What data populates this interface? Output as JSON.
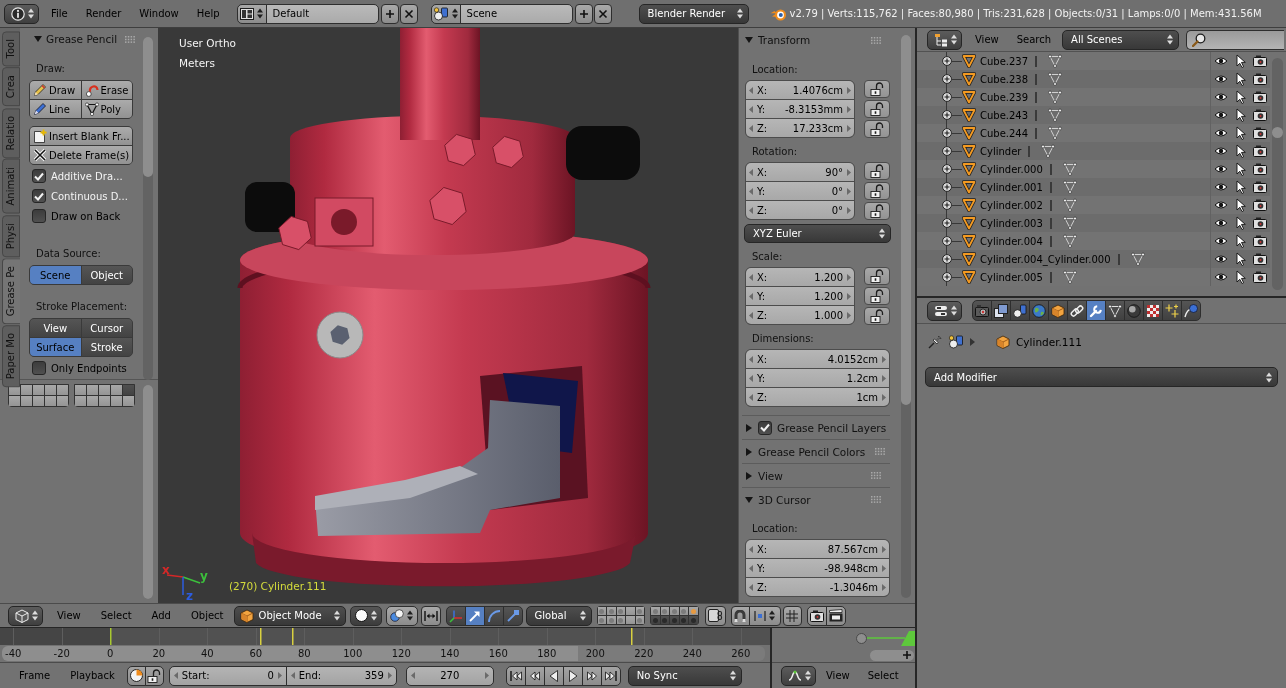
{
  "info_bar": {
    "menus": [
      "File",
      "Render",
      "Window",
      "Help"
    ],
    "screen_layout": "Default",
    "scene": "Scene",
    "render_engine": "Blender Render",
    "stats": "v2.79 | Verts:115,762 | Faces:80,980 | Tris:231,628 | Objects:0/31 | Lamps:0/0 | Mem:431.56M"
  },
  "tool_shelf": {
    "tabs": [
      {
        "label": "Tool",
        "selected": false
      },
      {
        "label": "Crea",
        "selected": false
      },
      {
        "label": "Relatio",
        "selected": false
      },
      {
        "label": "Animati",
        "selected": false
      },
      {
        "label": "Physi",
        "selected": false
      },
      {
        "label": "Grease Pe",
        "selected": true
      },
      {
        "label": "Paper Mo",
        "selected": false
      }
    ],
    "panel": {
      "title": "Grease Pencil",
      "expanded": true,
      "draw_label": "Draw:",
      "draw_tools": [
        {
          "kind": "draw",
          "label": "Draw"
        },
        {
          "kind": "erase",
          "label": "Erase"
        },
        {
          "kind": "line",
          "label": "Line"
        },
        {
          "kind": "poly",
          "label": "Poly"
        }
      ],
      "frame_actions": [
        {
          "kind": "insert",
          "label": "Insert Blank Fr..."
        },
        {
          "kind": "delete",
          "label": "Delete Frame(s)"
        }
      ],
      "options": [
        {
          "label": "Additive Dra...",
          "checked": true
        },
        {
          "label": "Continuous D...",
          "checked": true
        },
        {
          "label": "Draw on Back",
          "checked": false
        }
      ],
      "data_source": {
        "label": "Data Source:",
        "choices": [
          {
            "label": "Scene",
            "selected": true
          },
          {
            "label": "Object",
            "selected": false
          }
        ]
      },
      "stroke_placement": {
        "label": "Stroke Placement:",
        "choices": [
          {
            "label": "View",
            "selected": false
          },
          {
            "label": "Cursor",
            "selected": false
          },
          {
            "label": "Surface",
            "selected": true
          },
          {
            "label": "Stroke",
            "selected": false
          }
        ]
      },
      "endpoints": {
        "label": "Only Endpoints",
        "checked": false
      }
    },
    "redo_layers": [
      {
        "selected": false
      },
      {
        "selected": false
      },
      {
        "selected": false
      },
      {
        "selected": false
      },
      {
        "selected": false
      },
      {
        "selected": false
      },
      {
        "selected": false
      },
      {
        "selected": false
      },
      {
        "selected": false
      },
      {
        "selected": false
      },
      {
        "selected": false
      },
      {
        "selected": false
      },
      {
        "selected": false
      },
      {
        "selected": false
      },
      {
        "selected": true
      },
      {
        "selected": false
      },
      {
        "selected": false
      },
      {
        "selected": false
      },
      {
        "selected": false
      },
      {
        "selected": false
      }
    ]
  },
  "viewport": {
    "view_name": "User Ortho",
    "units": "Meters",
    "object_info": "(270) Cylinder.111",
    "axes": [
      {
        "label": "x",
        "color": "#d42828"
      },
      {
        "label": "y",
        "color": "#3cc03c"
      },
      {
        "label": "z",
        "color": "#2c5ce0"
      }
    ]
  },
  "sidebar": {
    "panels": [
      {
        "title": "Transform",
        "expanded": true,
        "groups": [
          {
            "kind": "vector",
            "label": "Location:",
            "fields": [
              {
                "axis": "X:",
                "value": "1.4076cm",
                "locked": false
              },
              {
                "axis": "Y:",
                "value": "-8.3153mm",
                "locked": false
              },
              {
                "axis": "Z:",
                "value": "17.233cm",
                "locked": false
              }
            ]
          },
          {
            "kind": "vector",
            "label": "Rotation:",
            "fields": [
              {
                "axis": "X:",
                "value": "90°",
                "locked": false
              },
              {
                "axis": "Y:",
                "value": "0°",
                "locked": false
              },
              {
                "axis": "Z:",
                "value": "0°",
                "locked": false
              }
            ]
          },
          {
            "kind": "dropdown",
            "value": "XYZ Euler"
          },
          {
            "kind": "vector",
            "label": "Scale:",
            "fields": [
              {
                "axis": "X:",
                "value": "1.200",
                "locked": false
              },
              {
                "axis": "Y:",
                "value": "1.200",
                "locked": false
              },
              {
                "axis": "Z:",
                "value": "1.000",
                "locked": false
              }
            ]
          },
          {
            "kind": "vector",
            "label": "Dimensions:",
            "fields": [
              {
                "axis": "X:",
                "value": "4.0152cm"
              },
              {
                "axis": "Y:",
                "value": "1.2cm"
              },
              {
                "axis": "Z:",
                "value": "1cm"
              }
            ]
          }
        ]
      },
      {
        "title": "Grease Pencil Layers",
        "expanded": false,
        "checked": true
      },
      {
        "title": "Grease Pencil Colors",
        "expanded": false
      },
      {
        "title": "View",
        "expanded": false
      },
      {
        "title": "3D Cursor",
        "expanded": true,
        "groups": [
          {
            "kind": "vector",
            "label": "Location:",
            "fields": [
              {
                "axis": "X:",
                "value": "87.567cm"
              },
              {
                "axis": "Y:",
                "value": "-98.948cm"
              },
              {
                "axis": "Z:",
                "value": "-1.3046m"
              }
            ]
          }
        ]
      }
    ]
  },
  "outliner": {
    "menus": [
      "View",
      "Search"
    ],
    "display_mode": "All Scenes",
    "rows": [
      {
        "name": "Cube.237",
        "expanded": false,
        "visible": true,
        "selectable": true,
        "renderable": true
      },
      {
        "name": "Cube.238",
        "expanded": false,
        "visible": true,
        "selectable": true,
        "renderable": true
      },
      {
        "name": "Cube.239",
        "expanded": false,
        "visible": true,
        "selectable": true,
        "renderable": true
      },
      {
        "name": "Cube.243",
        "expanded": false,
        "visible": true,
        "selectable": true,
        "renderable": true
      },
      {
        "name": "Cube.244",
        "expanded": false,
        "visible": true,
        "selectable": true,
        "renderable": true
      },
      {
        "name": "Cylinder",
        "expanded": false,
        "visible": true,
        "selectable": true,
        "renderable": true
      },
      {
        "name": "Cylinder.000",
        "expanded": false,
        "visible": true,
        "selectable": true,
        "renderable": true
      },
      {
        "name": "Cylinder.001",
        "expanded": false,
        "visible": true,
        "selectable": true,
        "renderable": true
      },
      {
        "name": "Cylinder.002",
        "expanded": false,
        "visible": true,
        "selectable": true,
        "renderable": true
      },
      {
        "name": "Cylinder.003",
        "expanded": false,
        "visible": true,
        "selectable": true,
        "renderable": true
      },
      {
        "name": "Cylinder.004",
        "expanded": false,
        "visible": true,
        "selectable": true,
        "renderable": true
      },
      {
        "name": "Cylinder.004_Cylinder.000",
        "expanded": false,
        "visible": true,
        "selectable": true,
        "renderable": true
      },
      {
        "name": "Cylinder.005",
        "expanded": false,
        "visible": true,
        "selectable": true,
        "renderable": true
      }
    ]
  },
  "properties": {
    "tabs": [
      {
        "kind": "render",
        "selected": false
      },
      {
        "kind": "render_layers",
        "selected": false
      },
      {
        "kind": "scene",
        "selected": false
      },
      {
        "kind": "world",
        "selected": false
      },
      {
        "kind": "object",
        "selected": false
      },
      {
        "kind": "constraints",
        "selected": false
      },
      {
        "kind": "modifiers",
        "selected": true
      },
      {
        "kind": "data",
        "selected": false
      },
      {
        "kind": "material",
        "selected": false
      },
      {
        "kind": "texture",
        "selected": false
      },
      {
        "kind": "particles",
        "selected": false
      },
      {
        "kind": "physics",
        "selected": false
      }
    ],
    "context_object": "Cylinder.111",
    "add_modifier": "Add Modifier"
  },
  "view3d_header": {
    "menus": [
      "View",
      "Select",
      "Add",
      "Object"
    ],
    "mode": "Object Mode",
    "manipulators": [
      {
        "kind": "widget",
        "selected": false
      },
      {
        "kind": "translate",
        "selected": true
      },
      {
        "kind": "rotate",
        "selected": false
      },
      {
        "kind": "scale",
        "selected": false
      }
    ],
    "orientation": "Global",
    "layers": [
      {
        "color": "#7c7c7c",
        "selected": false
      },
      {
        "color": "#7c7c7c",
        "selected": false
      },
      {
        "color": "#7c7c7c",
        "selected": false
      },
      {
        "selected": false
      },
      {
        "color": "#7c7c7c",
        "selected": false
      },
      {
        "color": "#7c7c7c",
        "selected": false
      },
      {
        "color": "#7c7c7c",
        "selected": false
      },
      {
        "color": "#7c7c7c",
        "selected": false
      },
      {
        "selected": false
      },
      {
        "color": "#7c7c7c",
        "selected": false
      },
      {
        "color": "#7c7c7c",
        "selected": false
      },
      {
        "color": "#7c7c7c",
        "selected": false
      },
      {
        "color": "#7c7c7c",
        "selected": false
      },
      {
        "color": "#7c7c7c",
        "selected": false
      },
      {
        "color": "#e89a40",
        "selected": false
      },
      {
        "color": "#2a2a2a",
        "selected": true
      },
      {
        "color": "#2a2a2a",
        "selected": true
      },
      {
        "color": "#2a2a2a",
        "selected": true
      },
      {
        "color": "#2a2a2a",
        "selected": true
      },
      {
        "color": "#2a2a2a",
        "selected": true
      }
    ]
  },
  "timeline": {
    "ruler": [
      "-40",
      "-20",
      "0",
      "20",
      "40",
      "60",
      "80",
      "100",
      "120",
      "140",
      "160",
      "180",
      "200",
      "220",
      "240",
      "260"
    ],
    "menus": [
      "Frame",
      "Playback"
    ],
    "start": {
      "label": "Start:",
      "value": "0"
    },
    "end": {
      "label": "End:",
      "value": "359"
    },
    "current_frame": "270",
    "sync": "No Sync"
  },
  "graph_editor": {
    "menus": [
      "View",
      "Select"
    ]
  }
}
